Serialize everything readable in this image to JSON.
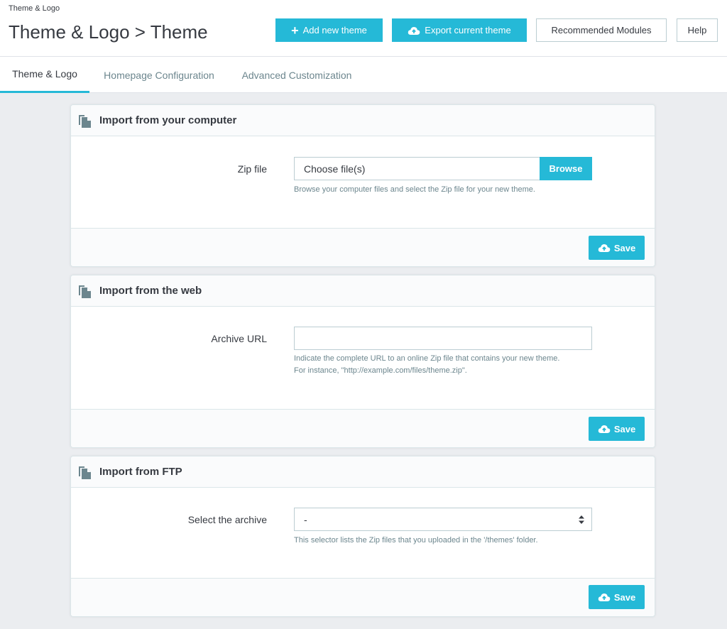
{
  "header": {
    "breadcrumb": "Theme & Logo",
    "title": "Theme & Logo > Theme"
  },
  "toolbar": {
    "add_new_theme_label": "Add new theme",
    "export_current_theme_label": "Export current theme",
    "recommended_modules_label": "Recommended Modules",
    "help_label": "Help"
  },
  "tabs": [
    {
      "label": "Theme & Logo",
      "active": true
    },
    {
      "label": "Homepage Configuration",
      "active": false
    },
    {
      "label": "Advanced Customization",
      "active": false
    }
  ],
  "panels": {
    "computer": {
      "title": "Import from your computer",
      "label": "Zip file",
      "value": "Choose file(s)",
      "browse_label": "Browse",
      "help": "Browse your computer files and select the Zip file for your new theme.",
      "save_label": "Save"
    },
    "web": {
      "title": "Import from the web",
      "label": "Archive URL",
      "value": "",
      "help_line1": "Indicate the complete URL to an online Zip file that contains your new theme.",
      "help_line2": "For instance, \"http://example.com/files/theme.zip\".",
      "save_label": "Save"
    },
    "ftp": {
      "title": "Import from FTP",
      "label": "Select the archive",
      "selected": "-",
      "help": "This selector lists the Zip files that you uploaded in the '/themes' folder.",
      "save_label": "Save"
    }
  },
  "icons": {
    "add": "plus-icon",
    "export": "cloud-upload-icon",
    "panel": "files-icon",
    "save": "cloud-upload-icon",
    "select": "sort-arrows-icon"
  },
  "colors": {
    "primary": "#25b9d7",
    "text": "#363a41",
    "muted": "#6c868e",
    "background": "#ebedf0"
  }
}
